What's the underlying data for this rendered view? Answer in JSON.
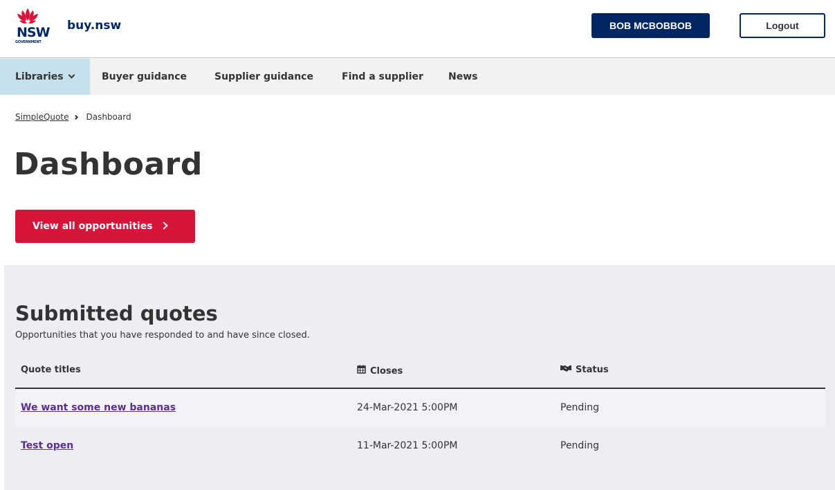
{
  "header": {
    "logo_text": "NSW",
    "logo_subtext": "GOVERNMENT",
    "brand": "buy.nsw",
    "user_label": "BOB MCBOBBOB",
    "logout_label": "Logout"
  },
  "nav": {
    "items": [
      {
        "label": "Libraries"
      },
      {
        "label": "Buyer guidance"
      },
      {
        "label": "Supplier guidance"
      },
      {
        "label": "Find a supplier"
      },
      {
        "label": "News"
      }
    ]
  },
  "breadcrumb": {
    "items": [
      "SimpleQuote",
      "Dashboard"
    ]
  },
  "page": {
    "title": "Dashboard",
    "cta_label": "View all opportunities"
  },
  "submitted": {
    "title": "Submitted quotes",
    "subtitle": "Opportunities that you have responded to and have since closed.",
    "columns": [
      {
        "label": "Quote titles",
        "icon": ""
      },
      {
        "label": "Closes",
        "icon": "calendar-icon"
      },
      {
        "label": "Status",
        "icon": "handshake-icon"
      }
    ],
    "rows": [
      {
        "title": "We want some new bananas",
        "closes": "24-Mar-2021 5:00PM",
        "status": "Pending"
      },
      {
        "title": "Test open",
        "closes": "11-Mar-2021 5:00PM",
        "status": "Pending"
      }
    ]
  },
  "colors": {
    "navy": "#002664",
    "red": "#d7153a",
    "link_purple": "#5b2d8e",
    "panel_bg": "#eceef3"
  }
}
